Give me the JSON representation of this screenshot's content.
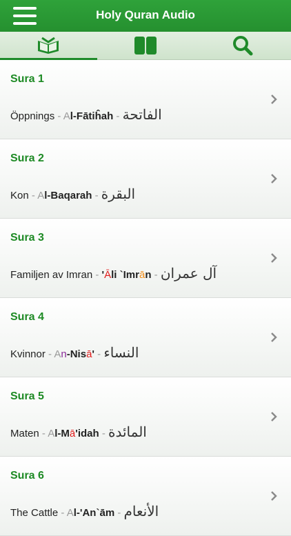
{
  "header": {
    "title": "Holy Quran Audio"
  },
  "icons": {
    "menu": "menu-icon",
    "quran": "quran-book-icon",
    "book": "open-book-icon",
    "search": "search-icon",
    "chevron": "chevron-right-icon"
  },
  "colors": {
    "brand_green": "#25902f",
    "sura_green": "#1d8a24"
  },
  "suras": [
    {
      "label": "Sura 1",
      "translation": "Öppnings",
      "translit": [
        [
          "A",
          "gray"
        ],
        [
          "l-Fātiĥah",
          "bold"
        ]
      ],
      "arabic": "الفاتحة"
    },
    {
      "label": "Sura 2",
      "translation": "Kon",
      "translit": [
        [
          "A",
          "gray"
        ],
        [
          "l-Baqarah",
          "bold"
        ]
      ],
      "arabic": "البقرة"
    },
    {
      "label": "Sura 3",
      "translation": "Familjen av Imran",
      "translit": [
        [
          "'",
          "bold"
        ],
        [
          "Ā",
          "red"
        ],
        [
          "li `Imr",
          "bold"
        ],
        [
          "ā",
          "orange"
        ],
        [
          "n",
          "bold"
        ]
      ],
      "arabic": "آل عمران"
    },
    {
      "label": "Sura 4",
      "translation": "Kvinnor",
      "translit": [
        [
          "A",
          "gray"
        ],
        [
          "n",
          "purple"
        ],
        [
          "-Nis",
          "bold"
        ],
        [
          "ā",
          "red"
        ],
        [
          "'",
          "bold"
        ]
      ],
      "arabic": "النساء"
    },
    {
      "label": "Sura 5",
      "translation": "Maten",
      "translit": [
        [
          "A",
          "gray"
        ],
        [
          "l-M",
          "bold"
        ],
        [
          "ā",
          "red"
        ],
        [
          "'idah",
          "bold"
        ]
      ],
      "arabic": "المائدة"
    },
    {
      "label": "Sura 6",
      "translation": "The Cattle",
      "translit": [
        [
          "A",
          "gray"
        ],
        [
          "l-'An`",
          "bold"
        ],
        [
          "ā",
          "bold"
        ],
        [
          "m",
          "bold"
        ]
      ],
      "arabic": "الأنعام"
    }
  ]
}
